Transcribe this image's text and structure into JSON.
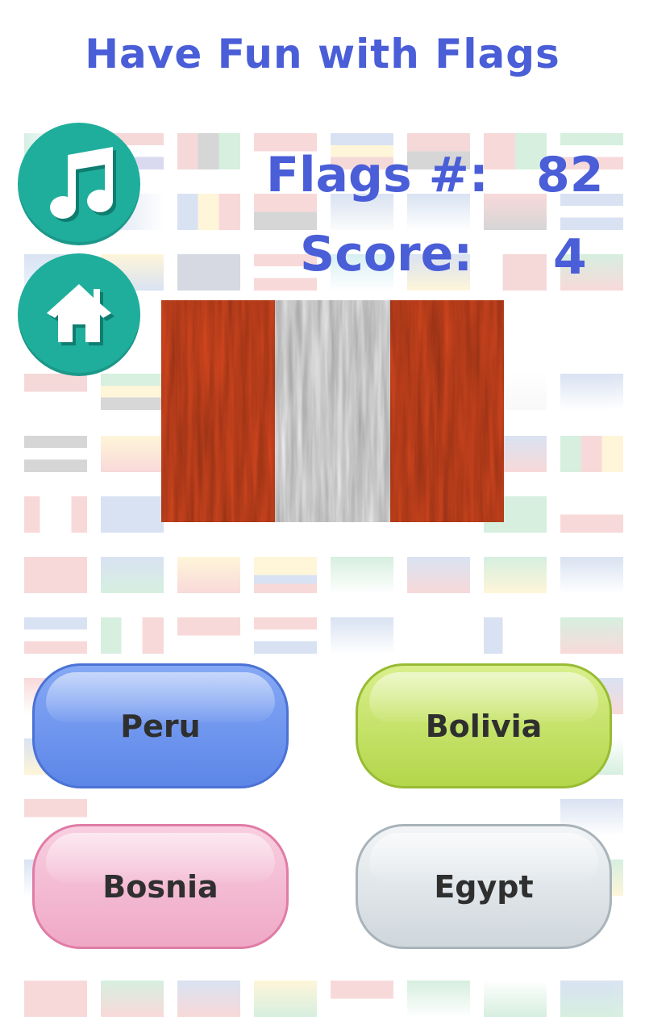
{
  "header": {
    "title": "Have Fun with Flags"
  },
  "controls": {
    "music_icon": "music-note-icon",
    "home_icon": "home-icon"
  },
  "stats": {
    "flags_label": "Flags #:",
    "flags_value": "82",
    "score_label": "Score:",
    "score_value": "4"
  },
  "flag": {
    "description": "peru-flag",
    "colors": [
      "#d9481f",
      "#f1f1f1",
      "#d9481f"
    ]
  },
  "answers": [
    {
      "label": "Peru",
      "color": "blue"
    },
    {
      "label": "Bolivia",
      "color": "green"
    },
    {
      "label": "Bosnia",
      "color": "pink"
    },
    {
      "label": "Egypt",
      "color": "gray"
    }
  ],
  "accent_color": "#4a5ed8",
  "button_color": "#1fae9c"
}
